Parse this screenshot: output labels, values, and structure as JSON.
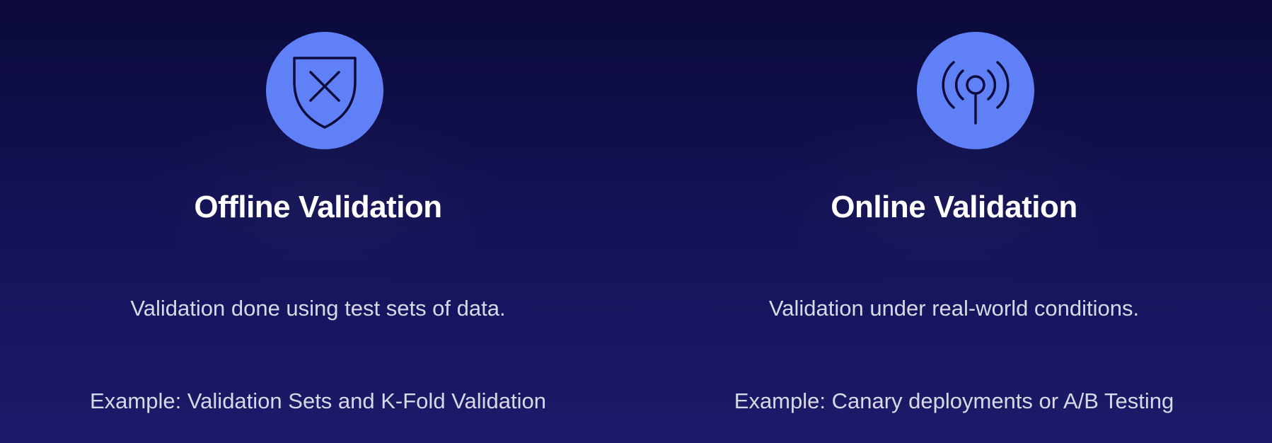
{
  "background_color": "#14135a",
  "accent_color": "#5f80f7",
  "cards": [
    {
      "icon": "shield-x-icon",
      "title": "Offline Validation",
      "description": "Validation done using test sets of data.",
      "example": "Example: Validation Sets and K-Fold Validation"
    },
    {
      "icon": "broadcast-antenna-icon",
      "title": "Online Validation",
      "description": "Validation under real-world conditions.",
      "example": "Example: Canary deployments or A/B Testing"
    }
  ]
}
